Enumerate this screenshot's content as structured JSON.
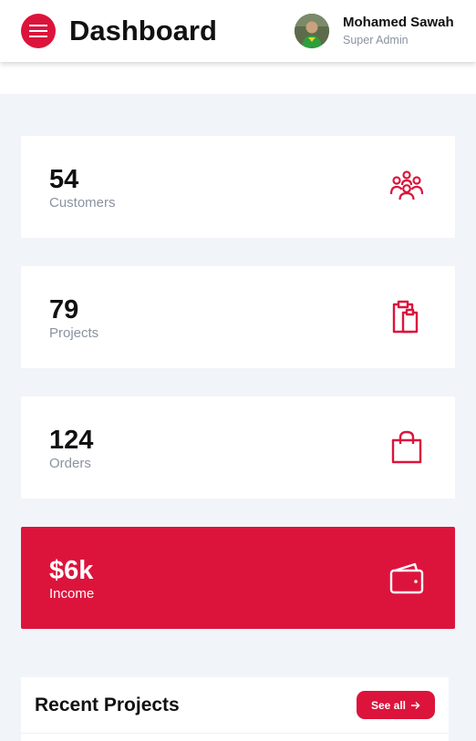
{
  "header": {
    "title": "Dashboard",
    "menu_icon": "hamburger-menu-icon",
    "user": {
      "name": "Mohamed Sawah",
      "role": "Super Admin"
    }
  },
  "stats": [
    {
      "value": "54",
      "label": "Customers",
      "icon": "users-group-icon"
    },
    {
      "value": "79",
      "label": "Projects",
      "icon": "clipboard-icon"
    },
    {
      "value": "124",
      "label": "Orders",
      "icon": "shopping-bag-icon"
    },
    {
      "value": "$6k",
      "label": "Income",
      "icon": "wallet-icon"
    }
  ],
  "recent_projects": {
    "title": "Recent Projects",
    "see_all_label": "See all",
    "see_all_icon": "arrow-right-icon"
  },
  "colors": {
    "accent": "#dc143c",
    "background": "#f1f4f8",
    "muted_text": "#8a93a0"
  }
}
